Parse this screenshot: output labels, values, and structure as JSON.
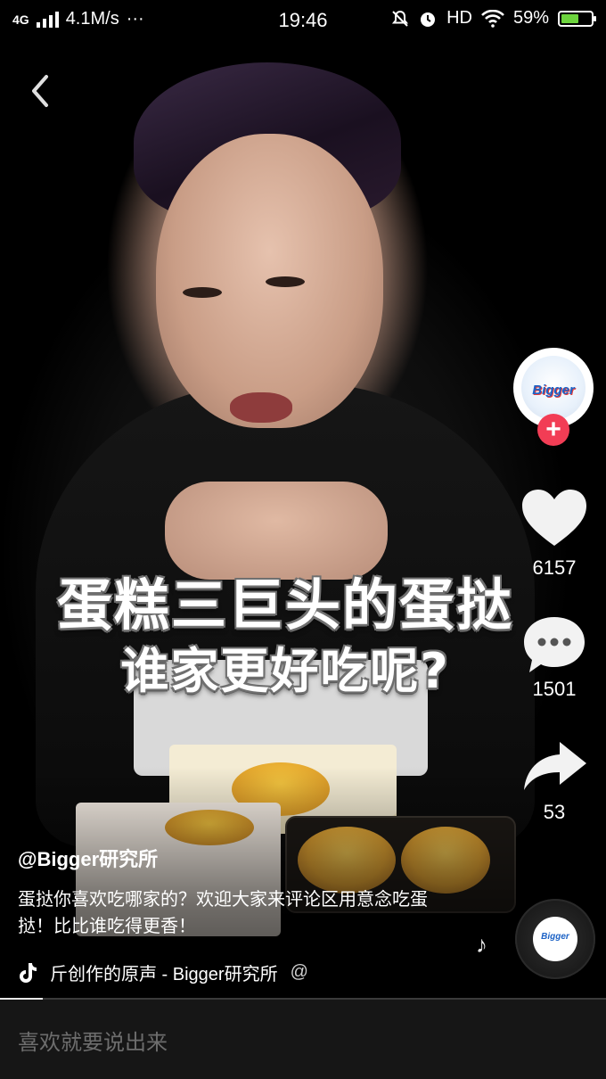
{
  "status_bar": {
    "network": "4G",
    "speed": "4.1M/s",
    "more": "···",
    "time": "19:46",
    "hd": "HD",
    "battery_text": "59%",
    "battery_level": 0.59,
    "battery_color": "#6dd43e"
  },
  "video": {
    "caption_line1": "蛋糕三巨头的蛋挞",
    "caption_line2": "谁家更好吃呢?",
    "progress": 0.07
  },
  "sidebar": {
    "avatar_logo_text": "Bigger",
    "follow_symbol": "+",
    "likes": "6157",
    "comments": "1501",
    "shares": "53"
  },
  "info": {
    "author": "@Bigger研究所",
    "description": "蛋挞你喜欢吃哪家的？欢迎大家来评论区用意念吃蛋挞！比比谁吃得更香！",
    "music": "斤创作的原声 - Bigger研究所",
    "music_tail": "@"
  },
  "comment_bar": {
    "placeholder": "喜欢就要说出来"
  },
  "colors": {
    "follow_button": "#f23d55",
    "background": "#000000"
  }
}
